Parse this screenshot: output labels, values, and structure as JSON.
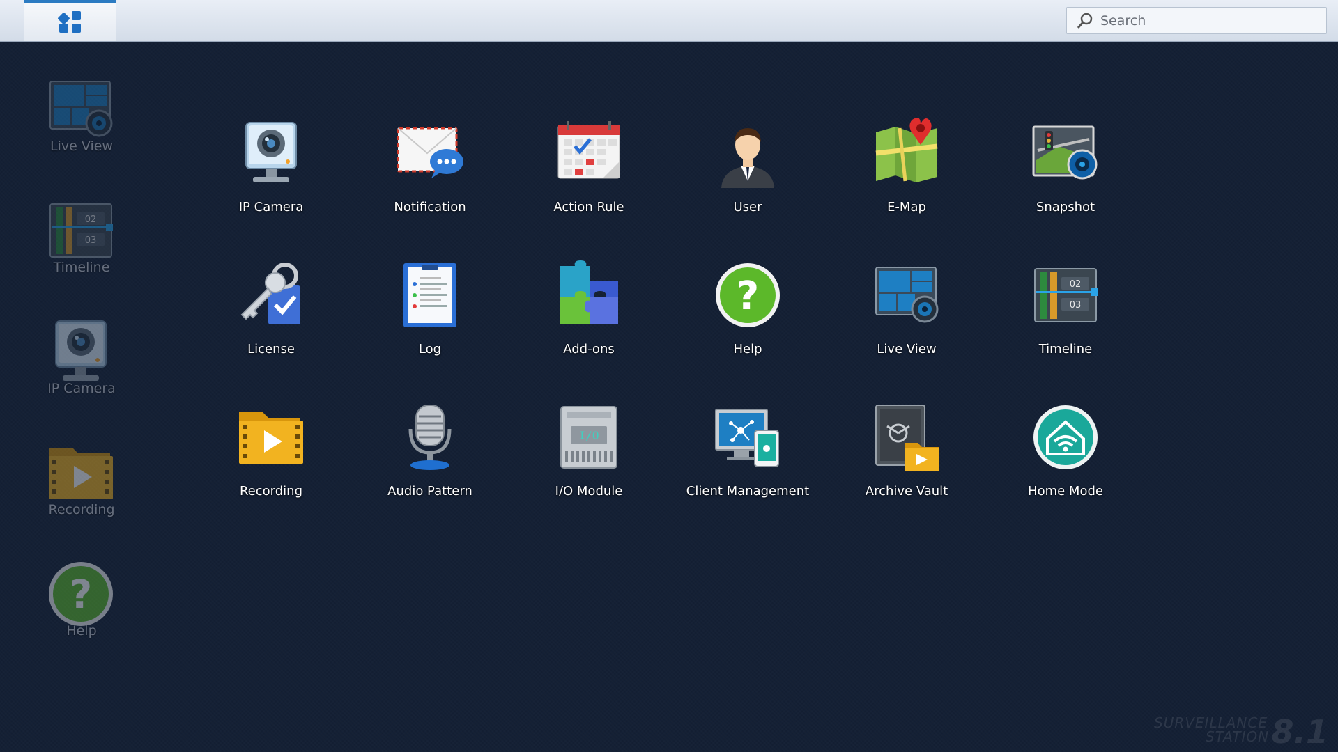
{
  "topbar": {
    "search_placeholder": "Search"
  },
  "sidebar": {
    "items": [
      {
        "label": "Live View",
        "icon": "live-view-icon"
      },
      {
        "label": "Timeline",
        "icon": "timeline-icon"
      },
      {
        "label": "IP Camera",
        "icon": "ip-camera-icon"
      },
      {
        "label": "Recording",
        "icon": "recording-icon"
      },
      {
        "label": "Help",
        "icon": "help-icon"
      }
    ]
  },
  "apps": [
    {
      "label": "IP Camera",
      "icon": "ip-camera-icon"
    },
    {
      "label": "Notification",
      "icon": "notification-icon"
    },
    {
      "label": "Action Rule",
      "icon": "action-rule-icon"
    },
    {
      "label": "User",
      "icon": "user-icon"
    },
    {
      "label": "E-Map",
      "icon": "e-map-icon"
    },
    {
      "label": "Snapshot",
      "icon": "snapshot-icon"
    },
    {
      "label": "License",
      "icon": "license-icon"
    },
    {
      "label": "Log",
      "icon": "log-icon"
    },
    {
      "label": "Add-ons",
      "icon": "add-ons-icon"
    },
    {
      "label": "Help",
      "icon": "help-icon"
    },
    {
      "label": "Live View",
      "icon": "live-view-icon"
    },
    {
      "label": "Timeline",
      "icon": "timeline-icon"
    },
    {
      "label": "Recording",
      "icon": "recording-icon"
    },
    {
      "label": "Audio Pattern",
      "icon": "audio-pattern-icon"
    },
    {
      "label": "I/O Module",
      "icon": "io-module-icon"
    },
    {
      "label": "Client Management",
      "icon": "client-management-icon"
    },
    {
      "label": "Archive Vault",
      "icon": "archive-vault-icon"
    },
    {
      "label": "Home Mode",
      "icon": "home-mode-icon"
    }
  ],
  "icon_text": {
    "timeline_02": "02",
    "timeline_03": "03",
    "io_module": "I/O",
    "help_mark": "?"
  },
  "watermark": {
    "line1": "SURVEILLANCE",
    "line2": "STATION",
    "version": "8.1"
  },
  "colors": {
    "background": "#142035",
    "accent": "#2c7bc2",
    "help_green": "#5cb82a",
    "home_teal": "#1aa89a"
  }
}
